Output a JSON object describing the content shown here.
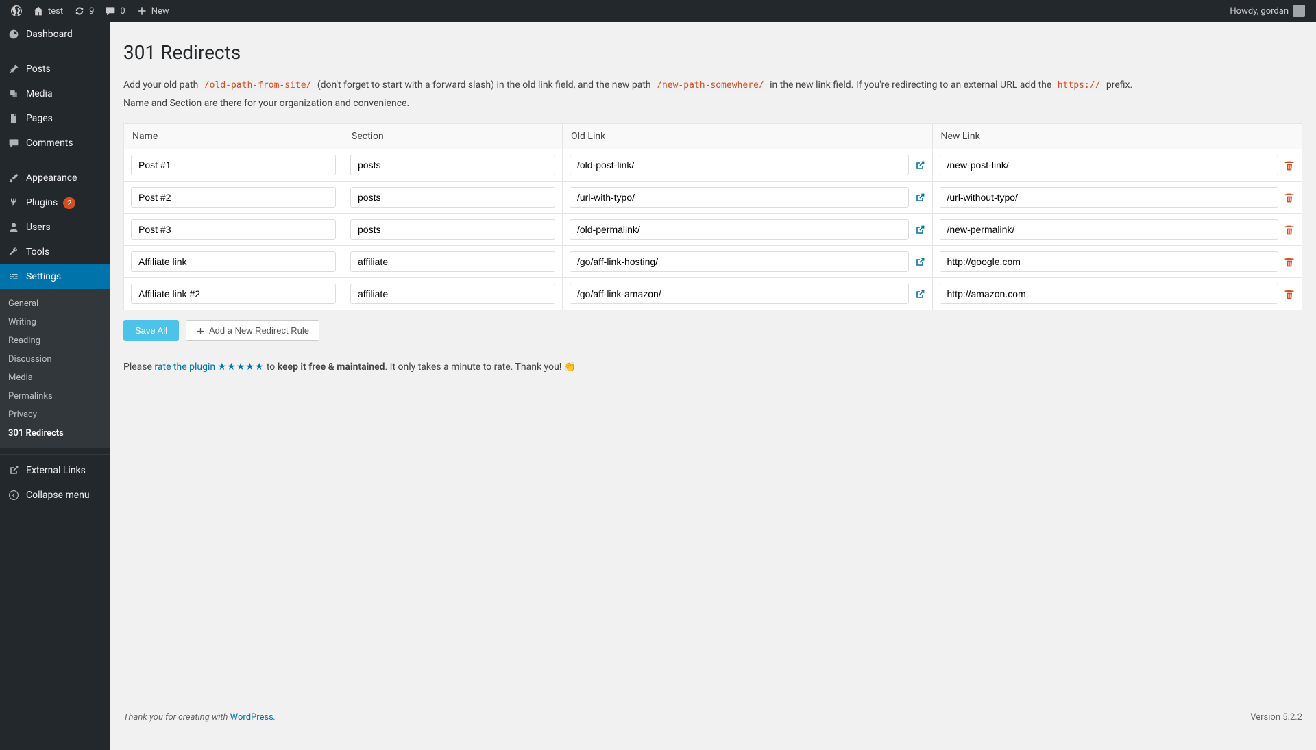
{
  "adminbar": {
    "site_name": "test",
    "updates": "9",
    "comments": "0",
    "new": "New",
    "howdy": "Howdy, gordan"
  },
  "sidebar": {
    "items": [
      {
        "label": "Dashboard",
        "icon": "dashboard"
      },
      {
        "label": "Posts",
        "icon": "posts"
      },
      {
        "label": "Media",
        "icon": "media"
      },
      {
        "label": "Pages",
        "icon": "pages"
      },
      {
        "label": "Comments",
        "icon": "comments"
      },
      {
        "label": "Appearance",
        "icon": "appearance"
      },
      {
        "label": "Plugins",
        "icon": "plugins",
        "badge": "2"
      },
      {
        "label": "Users",
        "icon": "users"
      },
      {
        "label": "Tools",
        "icon": "tools"
      },
      {
        "label": "Settings",
        "icon": "settings",
        "current": true
      },
      {
        "label": "External Links",
        "icon": "external"
      },
      {
        "label": "Collapse menu",
        "icon": "collapse"
      }
    ],
    "submenu": [
      {
        "label": "General"
      },
      {
        "label": "Writing"
      },
      {
        "label": "Reading"
      },
      {
        "label": "Discussion"
      },
      {
        "label": "Media"
      },
      {
        "label": "Permalinks"
      },
      {
        "label": "Privacy"
      },
      {
        "label": "301 Redirects",
        "current": true
      }
    ]
  },
  "page": {
    "title": "301 Redirects",
    "intro1a": "Add your old path ",
    "intro1_code1": "/old-path-from-site/",
    "intro1b": " (don't forget to start with a forward slash) in the old link field, and the new path ",
    "intro1_code2": "/new-path-somewhere/",
    "intro1c": " in the new link field. If you're redirecting to an external URL add the ",
    "intro1_code3": "https://",
    "intro1d": " prefix.",
    "intro2": "Name and Section are there for your organization and convenience.",
    "headers": {
      "name": "Name",
      "section": "Section",
      "old": "Old Link",
      "new": "New Link"
    },
    "rows": [
      {
        "name": "Post #1",
        "section": "posts",
        "old": "/old-post-link/",
        "new": "/new-post-link/"
      },
      {
        "name": "Post #2",
        "section": "posts",
        "old": "/url-with-typo/",
        "new": "/url-without-typo/"
      },
      {
        "name": "Post #3",
        "section": "posts",
        "old": "/old-permalink/",
        "new": "/new-permalink/"
      },
      {
        "name": "Affiliate link",
        "section": "affiliate",
        "old": "/go/aff-link-hosting/",
        "new": "http://google.com"
      },
      {
        "name": "Affiliate link #2",
        "section": "affiliate",
        "old": "/go/aff-link-amazon/",
        "new": "http://amazon.com"
      }
    ],
    "save_label": "Save All",
    "add_label": "Add a New Redirect Rule",
    "rate_please": "Please ",
    "rate_link": "rate the plugin ",
    "rate_stars": "★★★★★",
    "rate_to": " to ",
    "rate_strong": "keep it free & maintained",
    "rate_tail": ". It only takes a minute to rate. Thank you! ",
    "rate_emoji": "👏"
  },
  "footer": {
    "thanks_a": "Thank you for creating with ",
    "thanks_link": "WordPress",
    "thanks_dot": ".",
    "version": "Version 5.2.2"
  }
}
